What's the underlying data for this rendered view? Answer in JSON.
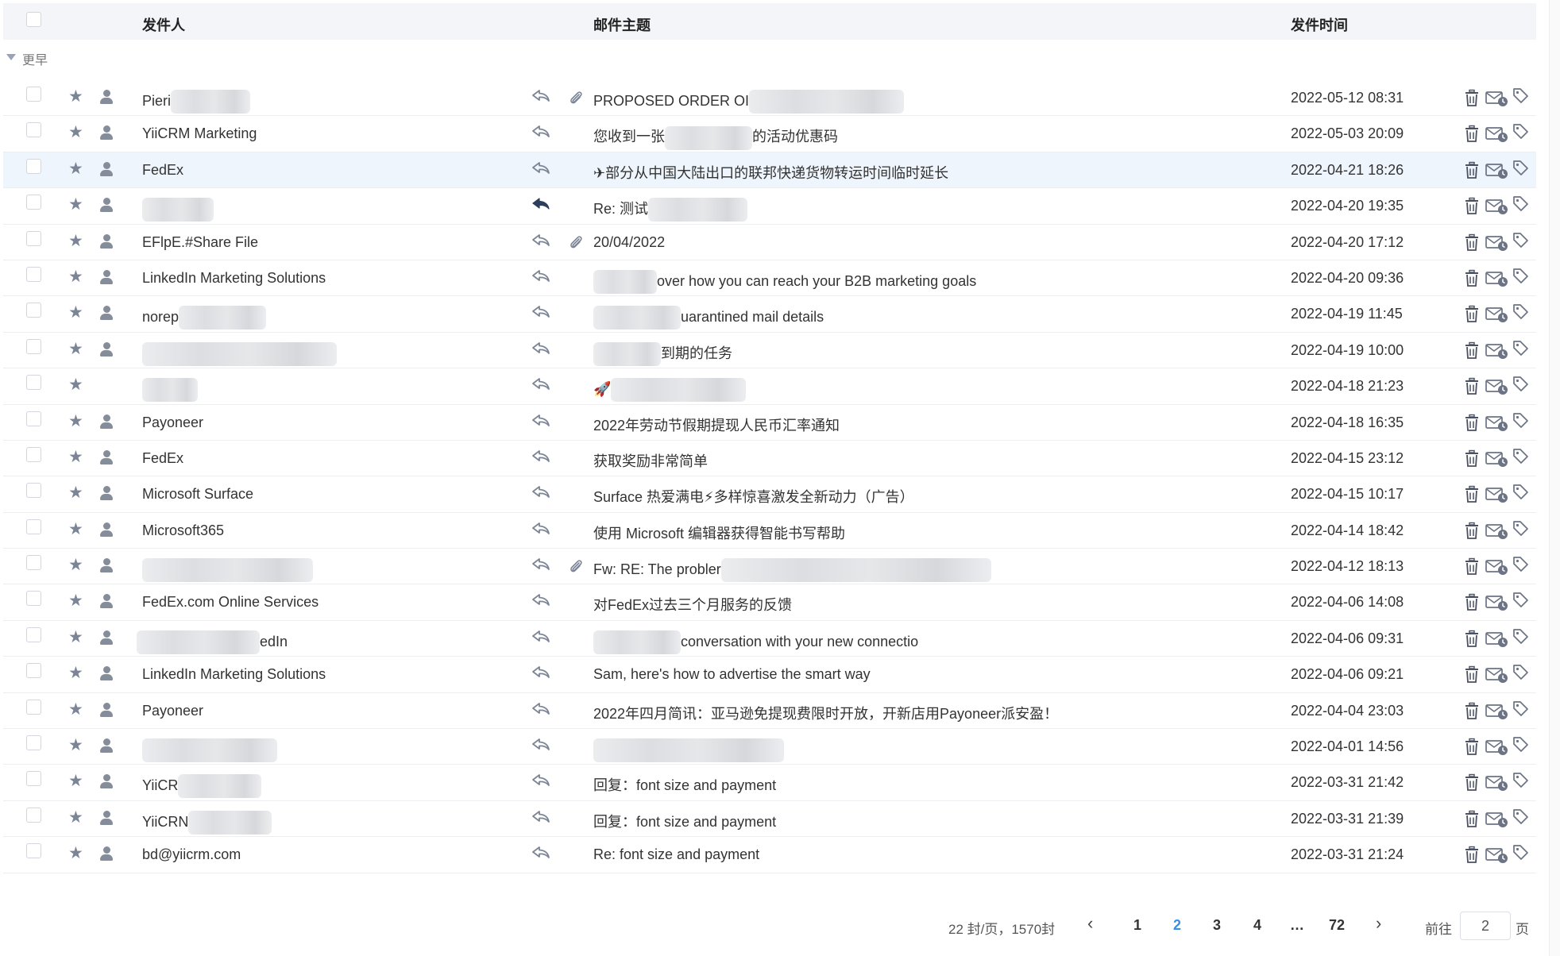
{
  "columns": {
    "sender": "发件人",
    "subject": "邮件主题",
    "time": "发件时间"
  },
  "group": {
    "label": "更早"
  },
  "emails": [
    {
      "sender": "Pieri",
      "subject": "PROPOSED ORDER OI",
      "time": "2022-05-12 08:31",
      "attachment": true,
      "replied": false
    },
    {
      "sender": "YiiCRM Marketing",
      "subject": "您收到一张",
      "subject_tail": "的活动优惠码",
      "time": "2022-05-03 20:09",
      "attachment": false,
      "replied": false
    },
    {
      "sender": "FedEx",
      "subject": "✈部分从中国大陆出口的联邦快递货物转运时间临时延长",
      "time": "2022-04-21 18:26",
      "attachment": false,
      "replied": false,
      "highlight": true
    },
    {
      "sender": "",
      "subject": "Re: 测试",
      "time": "2022-04-20 19:35",
      "attachment": false,
      "replied": true
    },
    {
      "sender": "EFlpE.#Share File",
      "subject": "20/04/2022",
      "time": "2022-04-20 17:12",
      "attachment": true,
      "replied": false
    },
    {
      "sender": "LinkedIn Marketing Solutions",
      "subject": "",
      "subject_tail": "over how you can reach your B2B marketing goals",
      "time": "2022-04-20 09:36",
      "attachment": false,
      "replied": false
    },
    {
      "sender": "norep",
      "subject": "",
      "subject_tail": "uarantined mail details",
      "time": "2022-04-19 11:45",
      "attachment": false,
      "replied": false
    },
    {
      "sender": "",
      "subject": "",
      "subject_tail": "到期的任务",
      "time": "2022-04-19 10:00",
      "attachment": false,
      "replied": false
    },
    {
      "sender": "",
      "subject": "🚀",
      "time": "2022-04-18 21:23",
      "attachment": false,
      "replied": false,
      "no_person": true
    },
    {
      "sender": "Payoneer",
      "subject": "2022年劳动节假期提现人民币汇率通知",
      "time": "2022-04-18 16:35",
      "attachment": false,
      "replied": false
    },
    {
      "sender": "FedEx",
      "subject": "获取奖励非常简单",
      "time": "2022-04-15 23:12",
      "attachment": false,
      "replied": false
    },
    {
      "sender": "Microsoft Surface",
      "subject": "Surface 热爱满电⚡多样惊喜激发全新动力（广告）",
      "time": "2022-04-15 10:17",
      "attachment": false,
      "replied": false
    },
    {
      "sender": "Microsoft365",
      "subject": "使用 Microsoft 编辑器获得智能书写帮助",
      "time": "2022-04-14 18:42",
      "attachment": false,
      "replied": false
    },
    {
      "sender": "",
      "subject": "Fw: RE: The probler",
      "time": "2022-04-12 18:13",
      "attachment": true,
      "replied": false
    },
    {
      "sender": "FedEx.com Online Services",
      "subject": "对FedEx过去三个月服务的反馈",
      "time": "2022-04-06 14:08",
      "attachment": false,
      "replied": false
    },
    {
      "sender": "",
      "sender_tail": "edIn",
      "subject": "",
      "subject_tail": "conversation with your new connectio",
      "time": "2022-04-06 09:31",
      "attachment": false,
      "replied": false
    },
    {
      "sender": "LinkedIn Marketing Solutions",
      "subject": "Sam, here's how to advertise the smart way",
      "time": "2022-04-06 09:21",
      "attachment": false,
      "replied": false
    },
    {
      "sender": "Payoneer",
      "subject": "2022年四月简讯：亚马逊免提现费限时开放，开新店用Payoneer派安盈！",
      "time": "2022-04-04 23:03",
      "attachment": false,
      "replied": false
    },
    {
      "sender": "",
      "subject": "",
      "time": "2022-04-01 14:56",
      "attachment": false,
      "replied": false
    },
    {
      "sender": "YiiCR",
      "subject": "回复：font size and payment",
      "time": "2022-03-31 21:42",
      "attachment": false,
      "replied": false
    },
    {
      "sender": "YiiCRN",
      "subject": "回复：font size and payment",
      "time": "2022-03-31 21:39",
      "attachment": false,
      "replied": false
    },
    {
      "sender": "bd@yiicrm.com",
      "subject": "Re: font size and payment",
      "time": "2022-03-31 21:24",
      "attachment": false,
      "replied": false
    }
  ],
  "pagination": {
    "summary": "22 封/页，1570封",
    "pages": [
      "1",
      "2",
      "3",
      "4",
      "…",
      "72"
    ],
    "current": "2",
    "goto_label": "前往",
    "goto_value": "2",
    "page_suffix": "页"
  },
  "colors": {
    "header_bg": "#f3f5f9",
    "highlight_row": "#eef5fd",
    "active_page": "#3a8ee6",
    "icon": "#7c8596"
  }
}
